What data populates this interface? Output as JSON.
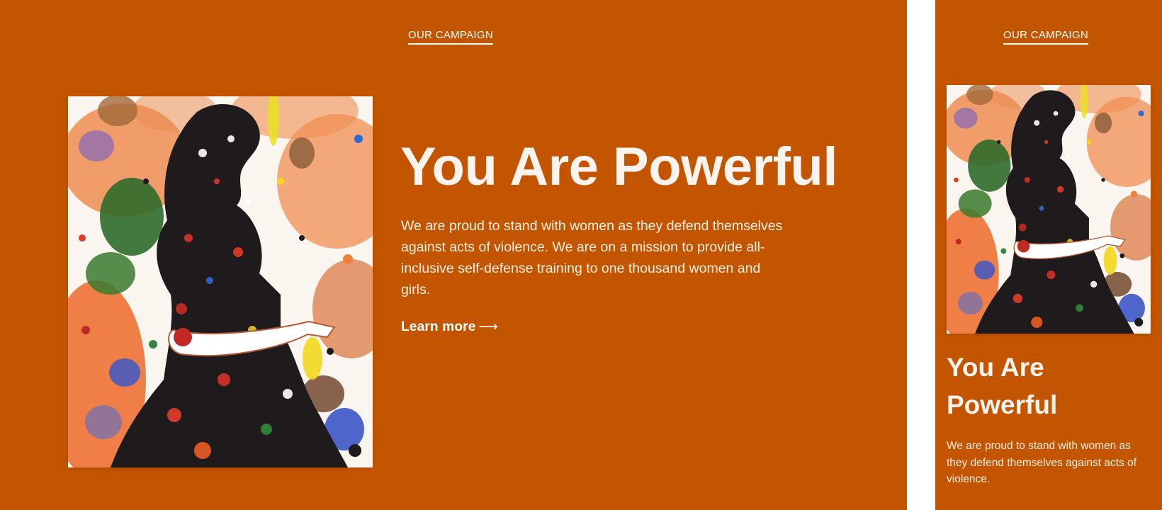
{
  "colors": {
    "brand": "#c45500",
    "text": "#ffffff",
    "page_gap": "#ffffff"
  },
  "desktop": {
    "nav": {
      "campaign_link": "OUR CAMPAIGN"
    },
    "hero": {
      "headline": "You Are Powerful",
      "body": "We are proud to stand with women as they defend themselves against acts of violence.  We are on a mission to provide all-inclusive self-defense training to one thousand women and girls.",
      "cta_label": "Learn more",
      "cta_icon": "arrow-right-icon",
      "image_subject": "splatter-art-woman-silhouette"
    }
  },
  "mobile": {
    "nav": {
      "campaign_link": "OUR CAMPAIGN"
    },
    "hero": {
      "headline": "You Are Powerful",
      "body": "We are proud to stand with women as they defend themselves against acts of violence.",
      "image_subject": "splatter-art-woman-silhouette"
    }
  }
}
